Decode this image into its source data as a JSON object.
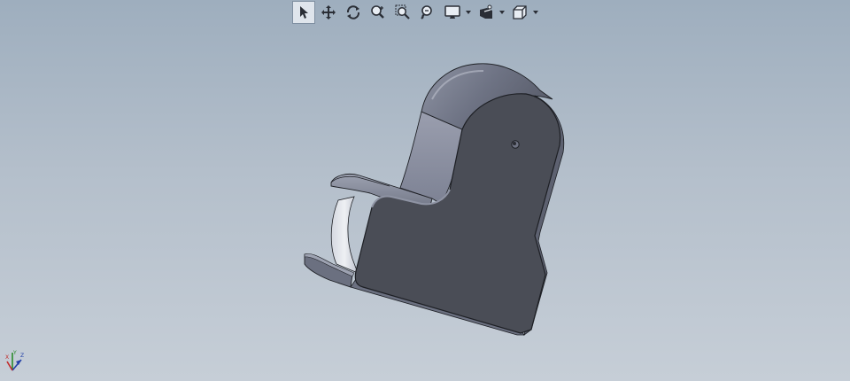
{
  "viewport": {
    "background_top": "#9eaebe",
    "background_bottom": "#c6ced7"
  },
  "toolbar": {
    "buttons": [
      {
        "icon": "select-arrow-icon",
        "selected": true
      },
      {
        "icon": "pan-icon"
      },
      {
        "icon": "rotate-icon"
      },
      {
        "icon": "zoom-to-fit-icon"
      },
      {
        "icon": "zoom-to-area-icon"
      },
      {
        "icon": "zoom-in-out-icon"
      },
      {
        "icon": "display-style-icon",
        "has_dropdown": true
      },
      {
        "icon": "hide-show-items-icon",
        "has_dropdown": true
      },
      {
        "icon": "view-orientation-icon",
        "has_dropdown": true
      }
    ]
  },
  "model": {
    "face_color": "#4a4d56",
    "edge_color": "#1d1f24",
    "highlight_color": "#8f94a4"
  },
  "triad": {
    "x_label": "X",
    "y_label": "Y",
    "z_label": "Z"
  }
}
